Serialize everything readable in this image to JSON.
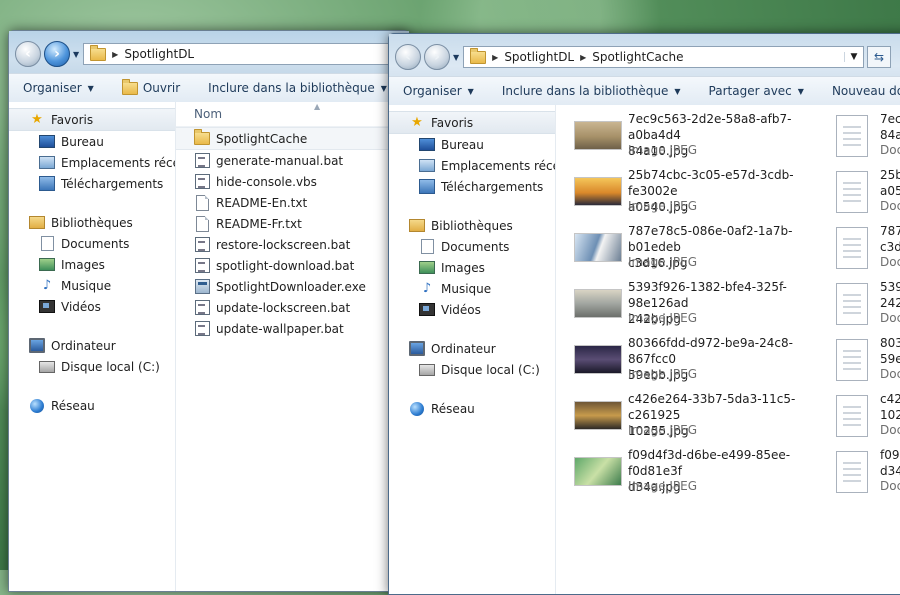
{
  "window_back": {
    "breadcrumb": [
      "SpotlightDL"
    ],
    "toolbar": [
      {
        "label": "Organiser",
        "dropdown": true
      },
      {
        "label": "Ouvrir",
        "dropdown": false
      },
      {
        "label": "Inclure dans la bibliothèque",
        "dropdown": true
      }
    ],
    "column_header": "Nom",
    "files": [
      {
        "name": "SpotlightCache",
        "icon": "folder-icon"
      },
      {
        "name": "generate-manual.bat",
        "icon": "batch-file-icon"
      },
      {
        "name": "hide-console.vbs",
        "icon": "script-file-icon"
      },
      {
        "name": "README-En.txt",
        "icon": "text-file-icon"
      },
      {
        "name": "README-Fr.txt",
        "icon": "text-file-icon"
      },
      {
        "name": "restore-lockscreen.bat",
        "icon": "batch-file-icon"
      },
      {
        "name": "spotlight-download.bat",
        "icon": "batch-file-icon"
      },
      {
        "name": "SpotlightDownloader.exe",
        "icon": "exe-file-icon"
      },
      {
        "name": "update-lockscreen.bat",
        "icon": "batch-file-icon"
      },
      {
        "name": "update-wallpaper.bat",
        "icon": "batch-file-icon"
      }
    ]
  },
  "window_front": {
    "breadcrumb": [
      "SpotlightDL",
      "SpotlightCache"
    ],
    "toolbar": [
      {
        "label": "Organiser",
        "dropdown": true
      },
      {
        "label": "Inclure dans la bibliothèque",
        "dropdown": true
      },
      {
        "label": "Partager avec",
        "dropdown": true
      },
      {
        "label": "Nouveau dossier",
        "dropdown": false
      }
    ],
    "tiles": [
      {
        "line1": "7ec9c563-2d2e-58a8-afb7-a0ba4d4",
        "line2": "84a10.jpg",
        "type": "Image JPEG"
      },
      {
        "line1": "25b74cbc-3c05-e57d-3cdb-fe3002e",
        "line2": "a0540.jpg",
        "type": "Image JPEG"
      },
      {
        "line1": "787e78c5-086e-0af2-1a7b-b01edeb",
        "line2": "c3d16.jpg",
        "type": "Image JPEG"
      },
      {
        "line1": "5393f926-1382-bfe4-325f-98e126ad",
        "line2": "242b.jpg",
        "type": "Image JPEG"
      },
      {
        "line1": "80366fdd-d972-be9a-24c8-867fcc0",
        "line2": "59ebb.jpg",
        "type": "Image JPEG"
      },
      {
        "line1": "c426e264-33b7-5da3-11c5-c261925",
        "line2": "10255.jpg",
        "type": "Image JPEG"
      },
      {
        "line1": "f09d4f3d-d6be-e499-85ee-f0d81e3f",
        "line2": "d34a.jpg",
        "type": "Image JPEG"
      }
    ],
    "tiles_col2": [
      {
        "line1": "7ec",
        "line2": "84a",
        "type": "Doc"
      },
      {
        "line1": "25b",
        "line2": "a05",
        "type": "Doc"
      },
      {
        "line1": "787",
        "line2": "c3d",
        "type": "Doc"
      },
      {
        "line1": "539",
        "line2": "242",
        "type": "Doc"
      },
      {
        "line1": "803",
        "line2": "59e",
        "type": "Doc"
      },
      {
        "line1": "c42",
        "line2": "102",
        "type": "Doc"
      },
      {
        "line1": "f09",
        "line2": "d34",
        "type": "Doc"
      }
    ]
  },
  "nav": {
    "favorites": {
      "label": "Favoris"
    },
    "fav_items": [
      "Bureau",
      "Emplacements récents",
      "Téléchargements"
    ],
    "libraries": {
      "label": "Bibliothèques"
    },
    "lib_items": [
      "Documents",
      "Images",
      "Musique",
      "Vidéos"
    ],
    "computer": {
      "label": "Ordinateur"
    },
    "computer_items": [
      "Disque local (C:)"
    ],
    "network": {
      "label": "Réseau"
    }
  },
  "icons": {
    "back": "back-arrow-icon",
    "forward": "forward-arrow-icon",
    "refresh": "refresh-icon"
  }
}
